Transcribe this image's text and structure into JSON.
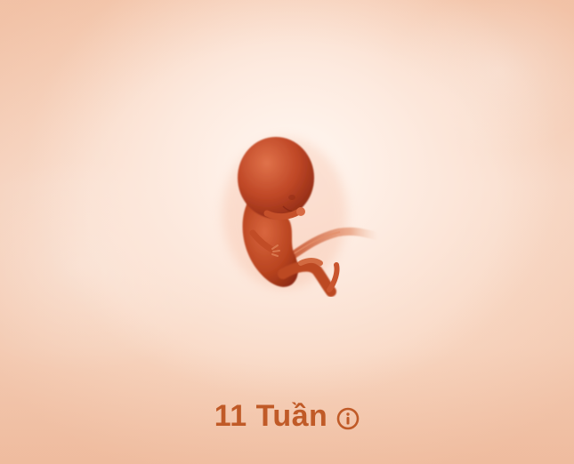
{
  "screen": {
    "title": "11 Tuần",
    "info_icon": "info-circle-icon",
    "accent_color": "#c05a27",
    "background_color": "#f8d6c1",
    "illustration": "fetus-illustration"
  }
}
